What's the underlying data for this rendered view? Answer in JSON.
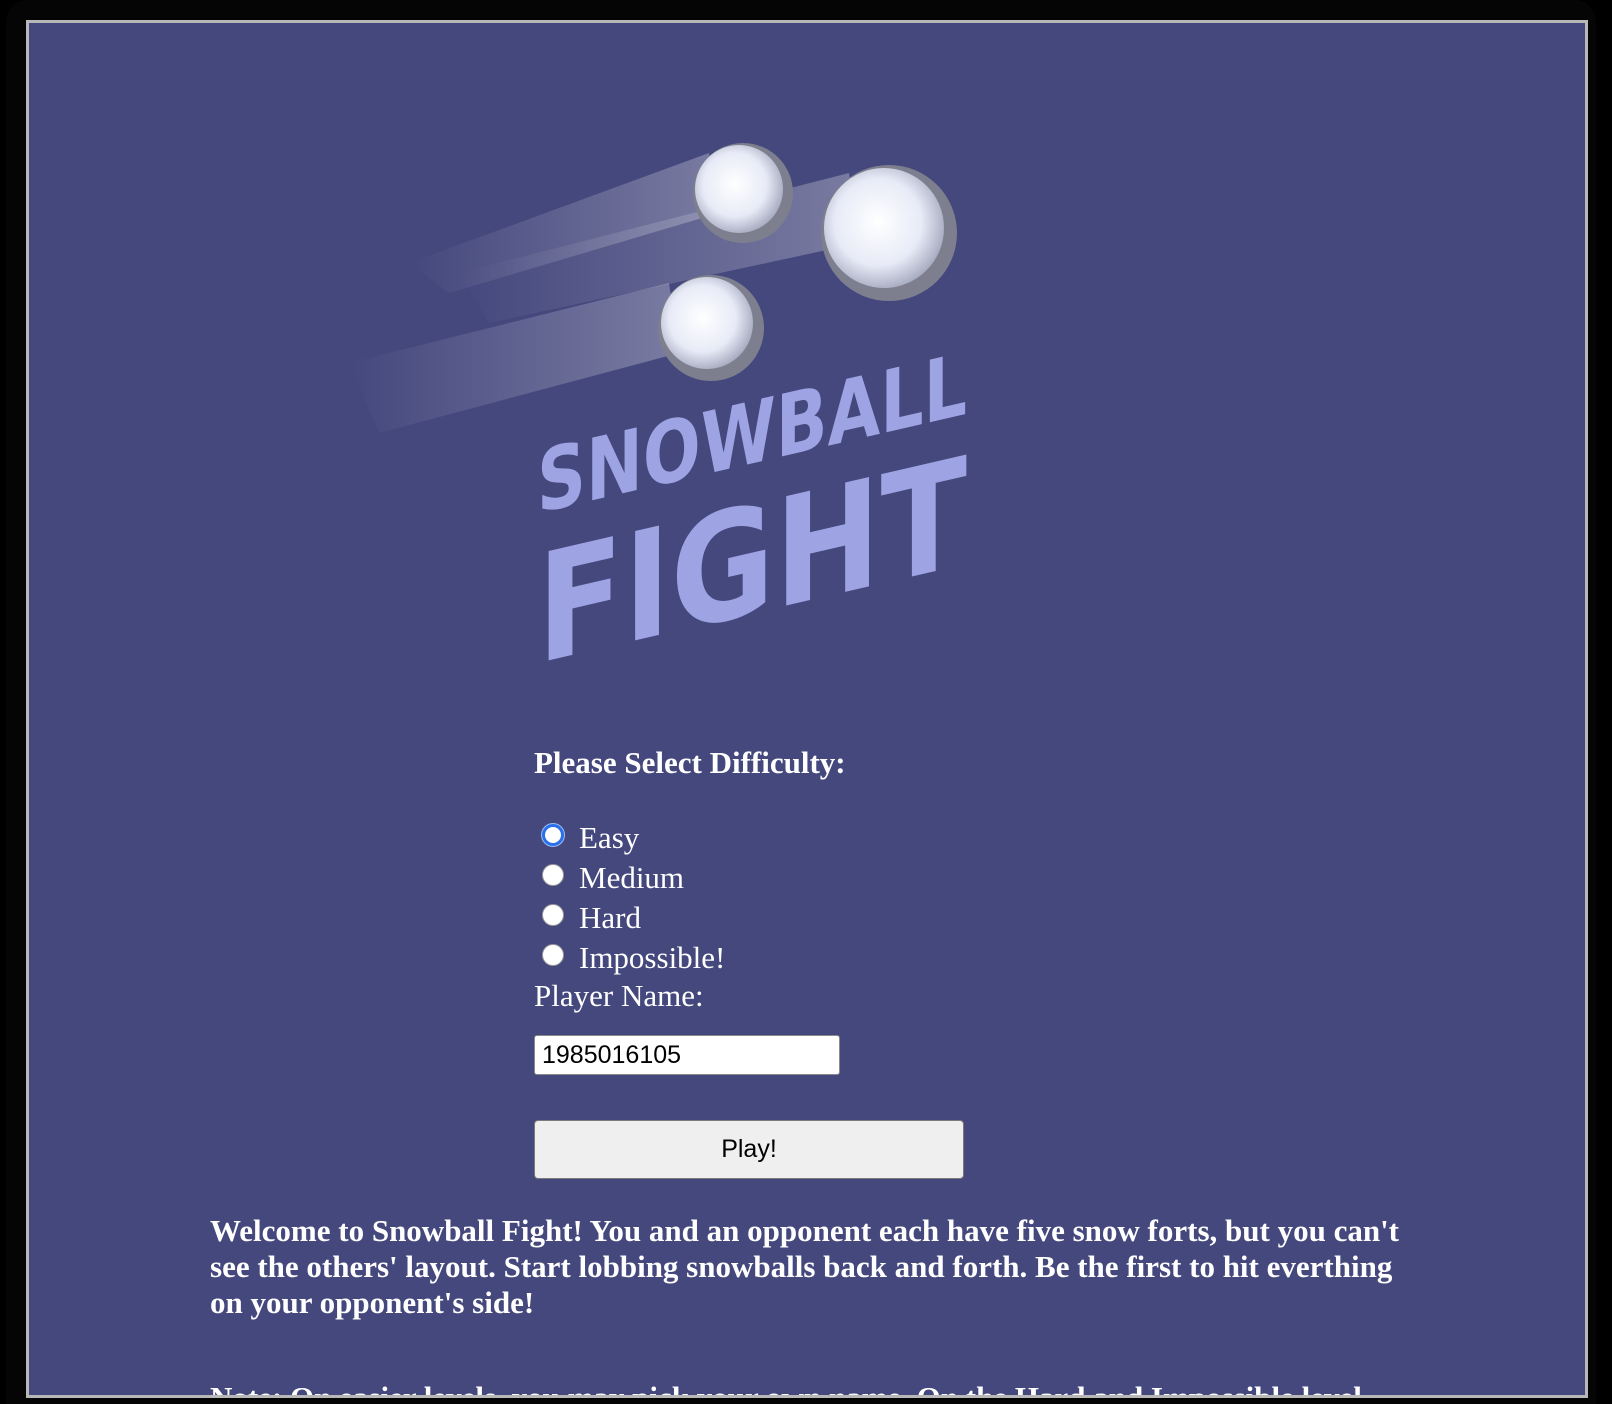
{
  "logo": {
    "line1": "SNOWBALL",
    "line2": "FIGHT",
    "text_color": "#9da3e3",
    "background": "#45487d"
  },
  "difficulty": {
    "heading": "Please Select Difficulty:",
    "options": [
      {
        "label": "Easy",
        "selected": true
      },
      {
        "label": "Medium",
        "selected": false
      },
      {
        "label": "Hard",
        "selected": false
      },
      {
        "label": "Impossible!",
        "selected": false
      }
    ]
  },
  "player": {
    "label": "Player Name:",
    "value": "1985016105"
  },
  "play_button": {
    "label": "Play!"
  },
  "description": {
    "welcome": "Welcome to Snowball Fight! You and an opponent each have five snow forts, but you can't see the others' layout. Start lobbing snowballs back and forth. Be the first to hit everthing on your opponent's side!",
    "note": "Note: On easier levels, you may pick your own name. On the Hard and Impossible level"
  },
  "colors": {
    "page_background": "#45487d",
    "selected_radio": "#2b6fe8"
  }
}
